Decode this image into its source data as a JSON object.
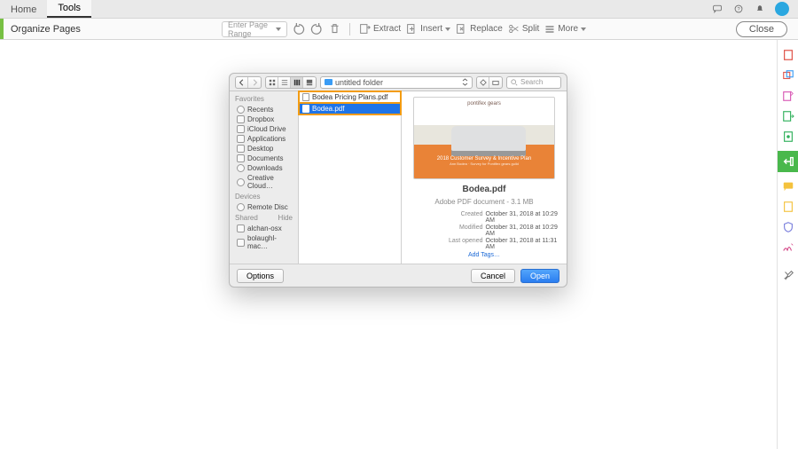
{
  "tabs": {
    "home": "Home",
    "tools": "Tools"
  },
  "toolbar": {
    "title": "Organize Pages",
    "pageRangePlaceholder": "Enter Page Range",
    "extract": "Extract",
    "insert": "Insert",
    "replace": "Replace",
    "split": "Split",
    "more": "More",
    "close": "Close"
  },
  "dialog": {
    "pathLabel": "untitled folder",
    "searchPlaceholder": "Search",
    "sidebar": {
      "favoritesHeader": "Favorites",
      "devicesHeader": "Devices",
      "sharedHeader": "Shared",
      "hide": "Hide",
      "favorites": [
        "Recents",
        "Dropbox",
        "iCloud Drive",
        "Applications",
        "Desktop",
        "Documents",
        "Downloads",
        "Creative Cloud…"
      ],
      "devices": [
        "Remote Disc"
      ],
      "shared": [
        "alchan-osx",
        "bolaughl-mac…"
      ]
    },
    "files": {
      "0": "Bodea Pricing Plans.pdf",
      "1": "Bodea.pdf"
    },
    "preview": {
      "logo": "pontifex gears",
      "banner1": "2018 Customer Survey & Incentive Plan",
      "banner2": "Ann Bodea · Survey for Pontifex gears guild",
      "filename": "Bodea.pdf",
      "kind": "Adobe PDF document - 3.1 MB",
      "createdLabel": "Created",
      "created": "October 31, 2018 at 10:29 AM",
      "modifiedLabel": "Modified",
      "modified": "October 31, 2018 at 10:29 AM",
      "openedLabel": "Last opened",
      "opened": "October 31, 2018 at 11:31 AM",
      "addTags": "Add Tags…"
    },
    "buttons": {
      "options": "Options",
      "cancel": "Cancel",
      "open": "Open"
    }
  }
}
